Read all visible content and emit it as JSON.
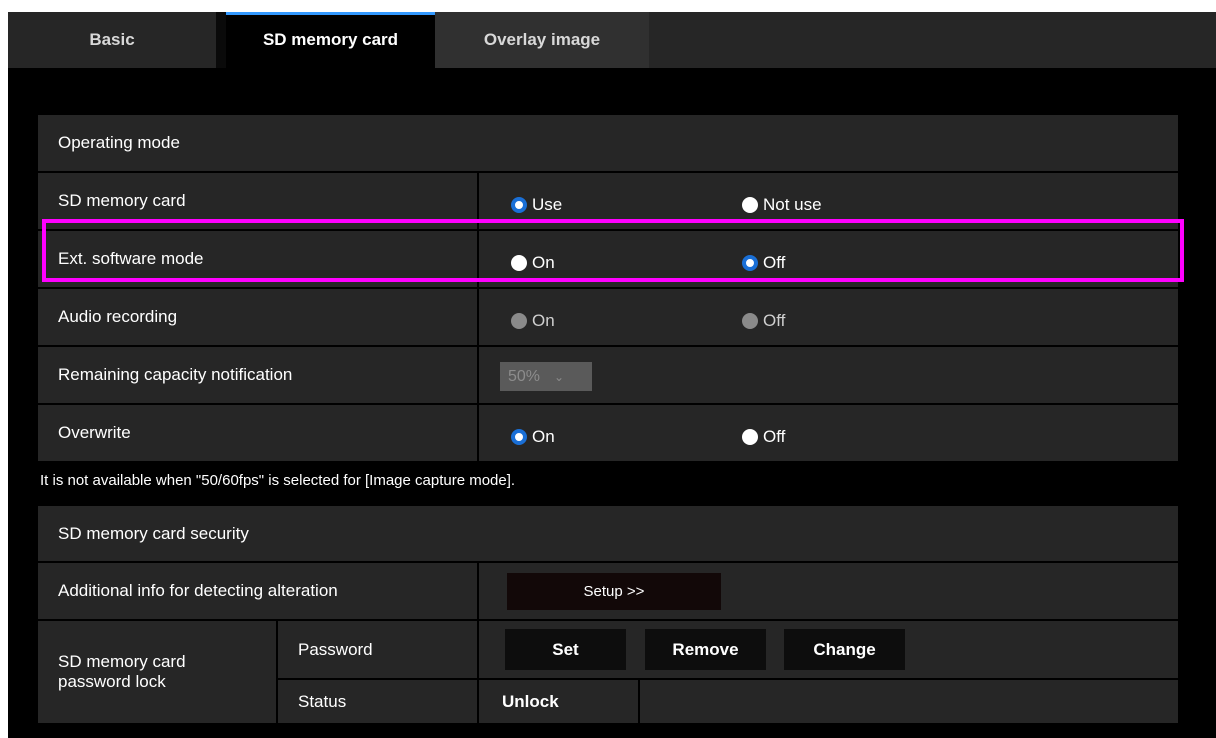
{
  "tabs": [
    {
      "label": "Basic"
    },
    {
      "label": "SD memory card"
    },
    {
      "label": "Overlay image"
    }
  ],
  "operating_mode": {
    "header": "Operating mode",
    "sd_memory_card": {
      "label": "SD memory card",
      "options": [
        "Use",
        "Not use"
      ],
      "selected": "Use"
    },
    "ext_software_mode": {
      "label": "Ext. software mode",
      "options": [
        "On",
        "Off"
      ],
      "selected": "Off"
    },
    "audio_recording": {
      "label": "Audio recording",
      "options": [
        "On",
        "Off"
      ],
      "disabled": true
    },
    "remaining_capacity": {
      "label": "Remaining capacity notification",
      "value": "50%",
      "disabled": true
    },
    "overwrite": {
      "label": "Overwrite",
      "options": [
        "On",
        "Off"
      ],
      "selected": "On"
    }
  },
  "note": "It is not available when \"50/60fps\" is selected for [Image capture mode].",
  "security": {
    "header": "SD memory card security",
    "additional_info": {
      "label": "Additional info for detecting alteration",
      "button": "Setup >>"
    },
    "password_lock": {
      "label_line1": "SD memory card",
      "label_line2": "password lock",
      "password_label": "Password",
      "buttons": [
        "Set",
        "Remove",
        "Change"
      ],
      "status_label": "Status",
      "status_value": "Unlock"
    }
  },
  "colors": {
    "accent": "#1a6fd6",
    "highlight": "#ff00ff",
    "tab_active_border": "#3399ff"
  }
}
